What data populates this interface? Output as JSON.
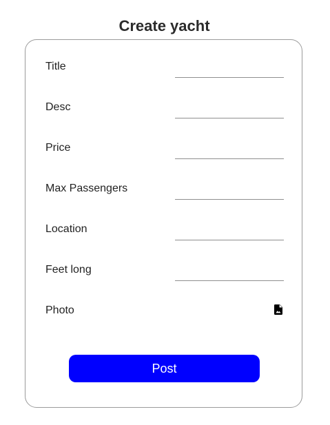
{
  "page": {
    "title": "Create yacht"
  },
  "form": {
    "fields": [
      {
        "label": "Title",
        "value": ""
      },
      {
        "label": "Desc",
        "value": ""
      },
      {
        "label": "Price",
        "value": ""
      },
      {
        "label": "Max Passengers",
        "value": ""
      },
      {
        "label": "Location",
        "value": ""
      },
      {
        "label": "Feet long",
        "value": ""
      }
    ],
    "photo": {
      "label": "Photo",
      "icon": "image-file-icon"
    },
    "submit_label": "Post"
  },
  "colors": {
    "button": "#0000ff",
    "button_text": "#ffffff",
    "card_border": "#9a9a9a",
    "title": "#2b2b2b"
  }
}
